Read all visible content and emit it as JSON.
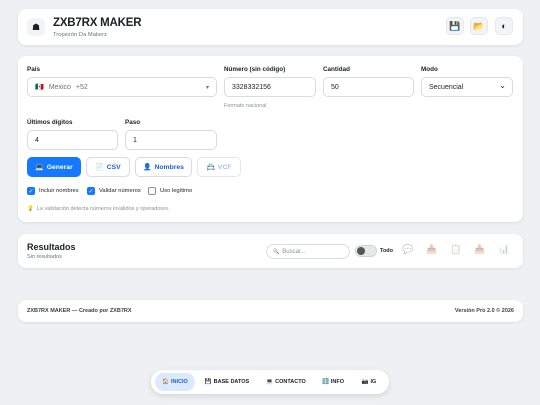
{
  "header": {
    "logo_icon": "☗",
    "title": "ZXB7RX MAKER",
    "subtitle": "Tropezón Da Makerz",
    "actions": [
      {
        "name": "save",
        "icon": "💾"
      },
      {
        "name": "folder",
        "icon": "📂"
      },
      {
        "name": "theme",
        "icon": "◐"
      }
    ]
  },
  "form": {
    "country_label": "País",
    "country_flag": "🇲🇽",
    "country_name": "Mexico",
    "country_code": "+52",
    "country_chevron": "▾",
    "number_label": "Número (sin código)",
    "number_value": "3328332156",
    "number_helper": "Formato nacional",
    "quantity_label": "Cantidad",
    "quantity_value": "50",
    "mode_label": "Modo",
    "mode_value": "Secuencial",
    "mode_chevron": "⌄",
    "last_digits_label": "Últimos dígitos",
    "last_digits_value": "4",
    "step_label": "Paso",
    "step_value": "1",
    "buttons": {
      "generate": {
        "icon": "💻",
        "label": "Generar"
      },
      "csv": {
        "icon": "📄",
        "label": "CSV"
      },
      "names": {
        "icon": "👤",
        "label": "Nombres"
      },
      "vcf": {
        "icon": "📇",
        "label": "VCF"
      }
    },
    "checkboxes": {
      "include_names": {
        "label": "Incluir nombres",
        "checked": true
      },
      "validate_numbers": {
        "label": "Validar números",
        "checked": true
      },
      "legit_use": {
        "label": "Uso legítimo",
        "checked": false
      }
    },
    "note_icon": "💡",
    "note": "La validación detecta números inválidos y operadores."
  },
  "results": {
    "title": "Resultados",
    "subtitle": "Sin resultados",
    "search_placeholder": "Buscar...",
    "search_icon": "🔍",
    "toggle_label": "Todo",
    "toggle_on": false,
    "icons": [
      {
        "name": "whatsapp-icon",
        "glyph": "💬"
      },
      {
        "name": "download-icon",
        "glyph": "📥"
      },
      {
        "name": "copy-icon",
        "glyph": "📋"
      },
      {
        "name": "download-alt-icon",
        "glyph": "📥"
      },
      {
        "name": "stats-icon",
        "glyph": "📊"
      }
    ]
  },
  "footer": {
    "left": "ZXB7RX MAKER — Creado por ZXB7RX",
    "right": "Versión Pro 2.0 © 2026"
  },
  "bottom_nav": [
    {
      "icon": "🏠",
      "label": "INICIO",
      "active": true
    },
    {
      "icon": "💾",
      "label": "BASE DATOS",
      "active": false
    },
    {
      "icon": "💻",
      "label": "CONTACTO",
      "active": false
    },
    {
      "icon": "ℹ️",
      "label": "INFO",
      "active": false
    },
    {
      "icon": "📷",
      "label": "IG",
      "active": false
    }
  ]
}
